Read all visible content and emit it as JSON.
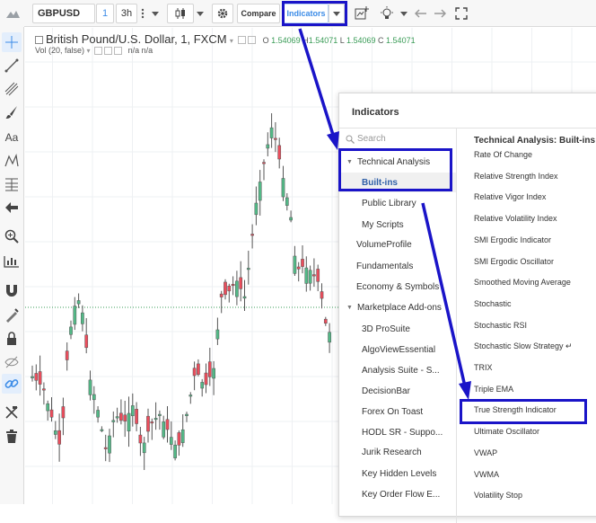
{
  "toolbar": {
    "symbol": "GBPUSD",
    "intervals": [
      "1",
      "3h"
    ],
    "compare_label": "Compare",
    "indicators_label": "Indicators",
    "icons": [
      "candles-icon",
      "gear-icon",
      "add-chart-icon",
      "lightbulb-icon",
      "undo-icon",
      "redo-icon",
      "fullscreen-icon"
    ]
  },
  "left_toolbar": {
    "icons": [
      "crosshair-icon",
      "trend-line-icon",
      "pitchfork-icon",
      "brush-icon",
      "text-icon",
      "pattern-icon",
      "fib-icon",
      "arrow-left-icon",
      "zoom-icon",
      "measure-icon",
      "magnet-icon",
      "stay-drawing-icon",
      "lock-icon",
      "eye-icon",
      "link-icon",
      "remove-drawings-icon",
      "trash-icon"
    ],
    "text_tool_label": "Aa"
  },
  "chart": {
    "title": "British Pound/U.S. Dollar, 1, FXCM",
    "ohlc": [
      {
        "label": "O",
        "value": "1.54069"
      },
      {
        "label": "H",
        "value": "1.54071"
      },
      {
        "label": "L",
        "value": "1.54069"
      },
      {
        "label": "C",
        "value": "1.54071"
      }
    ],
    "volume_label": "Vol (20, false)",
    "volume_values": "n/a n/a",
    "colors": {
      "up": "#53b987",
      "down": "#eb4d5c",
      "grid": "#eef0f3",
      "price_line": "#3a9c57"
    }
  },
  "dialog": {
    "title": "Indicators",
    "search_placeholder": "Search",
    "categories": [
      {
        "label": "Technical Analysis",
        "kind": "expanded"
      },
      {
        "label": "Built-ins",
        "kind": "sub",
        "selected": true
      },
      {
        "label": "Public Library",
        "kind": "sub"
      },
      {
        "label": "My Scripts",
        "kind": "sub"
      },
      {
        "label": "VolumeProfile",
        "kind": "top"
      },
      {
        "label": "Fundamentals",
        "kind": "top"
      },
      {
        "label": "Economy & Symbols",
        "kind": "top"
      },
      {
        "label": "Marketplace Add-ons",
        "kind": "expanded"
      },
      {
        "label": "3D ProSuite",
        "kind": "sub"
      },
      {
        "label": "AlgoViewEssential",
        "kind": "sub"
      },
      {
        "label": "Analysis Suite - S...",
        "kind": "sub"
      },
      {
        "label": "DecisionBar",
        "kind": "sub"
      },
      {
        "label": "Forex On Toast",
        "kind": "sub"
      },
      {
        "label": "HODL SR - Suppo...",
        "kind": "sub"
      },
      {
        "label": "Jurik Research",
        "kind": "sub"
      },
      {
        "label": "Key Hidden Levels",
        "kind": "sub"
      },
      {
        "label": "Key Order Flow E...",
        "kind": "sub"
      }
    ],
    "right_header": "Technical Analysis: Built-ins",
    "indicators": [
      "Rate Of Change",
      "Relative Strength Index",
      "Relative Vigor Index",
      "Relative Volatility Index",
      "SMI Ergodic Indicator",
      "SMI Ergodic Oscillator",
      "Smoothed Moving Average",
      "Stochastic",
      "Stochastic RSI",
      "Stochastic Slow Strategy ↵",
      "TRIX",
      "Triple EMA",
      "True Strength Indicator",
      "Ultimate Oscillator",
      "VWAP",
      "VWMA",
      "Volatility Stop"
    ],
    "highlighted_indicator": "True Strength Indicator"
  },
  "annotation": {
    "color": "#1a14c8"
  }
}
